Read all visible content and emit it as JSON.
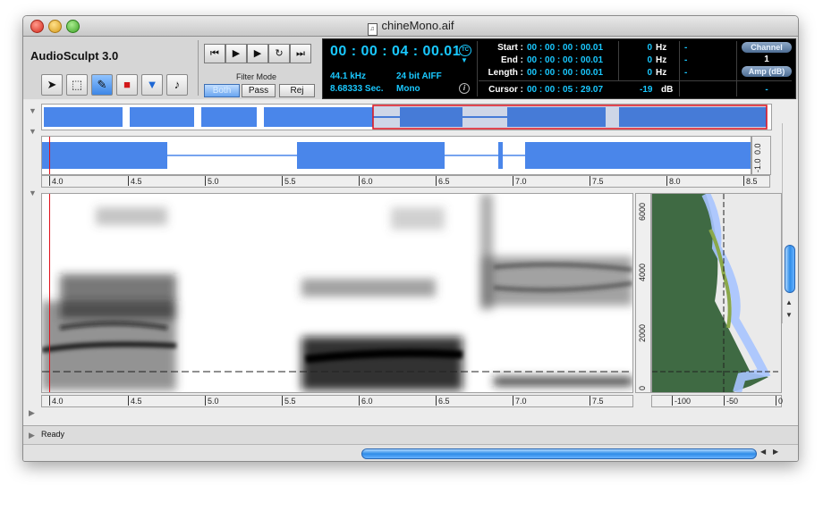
{
  "window": {
    "title": "chineMono.aif",
    "doc_icon": "♫"
  },
  "app": {
    "name": "AudioSculpt 3.0"
  },
  "tools": [
    {
      "name": "arrow-tool",
      "glyph": "➤"
    },
    {
      "name": "marquee-tool",
      "glyph": "⬚"
    },
    {
      "name": "pencil-tool",
      "glyph": "✎"
    },
    {
      "name": "color-tool",
      "glyph": "■"
    },
    {
      "name": "filter-tool",
      "glyph": "▼"
    },
    {
      "name": "note-tool",
      "glyph": "♪"
    }
  ],
  "transport": [
    {
      "name": "skip-start-button",
      "glyph": "⏮"
    },
    {
      "name": "play-button",
      "glyph": "▶"
    },
    {
      "name": "play-selection-button",
      "glyph": "▶"
    },
    {
      "name": "loop-button",
      "glyph": "↻"
    },
    {
      "name": "skip-end-button",
      "glyph": "⏭"
    }
  ],
  "filter_mode": {
    "label": "Filter Mode",
    "options": [
      "Both",
      "Pass",
      "Rej"
    ],
    "selected": "Both"
  },
  "lcd": {
    "timecode": "00 : 00 : 04 : 00.01",
    "tc_badge": "TC",
    "tc_arrow": "▼",
    "sample_rate": "44.1 kHz",
    "format": "24 bit AIFF",
    "duration": "8.68333 Sec.",
    "channels": "Mono",
    "info": "i",
    "start_label": "Start :",
    "start_value": "00 : 00 : 00 : 00.01",
    "end_label": "End :",
    "end_value": "00 : 00 : 00 : 00.01",
    "length_label": "Length :",
    "length_value": "00 : 00 : 00 : 00.01",
    "cursor_label": "Cursor :",
    "cursor_value": "00 : 00 : 05 : 29.07",
    "freq1": "0",
    "freq2": "0",
    "freq3": "0",
    "hz": "Hz",
    "dash1": "-",
    "dash2": "-",
    "dash3": "-",
    "cursor_db": "-19",
    "db": "dB",
    "channel_label": "Channel",
    "channel_value": "1",
    "amp_label": "Amp (dB)",
    "amp_value": "-"
  },
  "ruler_ticks": [
    "4.0",
    "4.5",
    "5.0",
    "5.5",
    "6.0",
    "6.5",
    "7.0",
    "7.5",
    "8.0",
    "8.5"
  ],
  "amp_axis": {
    "top": "0.0",
    "bottom": "-1.0"
  },
  "freq_axis": [
    "6000",
    "4000",
    "2000",
    "0"
  ],
  "spectrum_axis": [
    "-100",
    "-50",
    "0"
  ],
  "status": {
    "text": "Ready"
  },
  "colors": {
    "waveform": "#4a86ea",
    "lcd_text": "#19c8ff",
    "cursor": "#e0101a",
    "spectrum_fill": "#3f6a43"
  }
}
